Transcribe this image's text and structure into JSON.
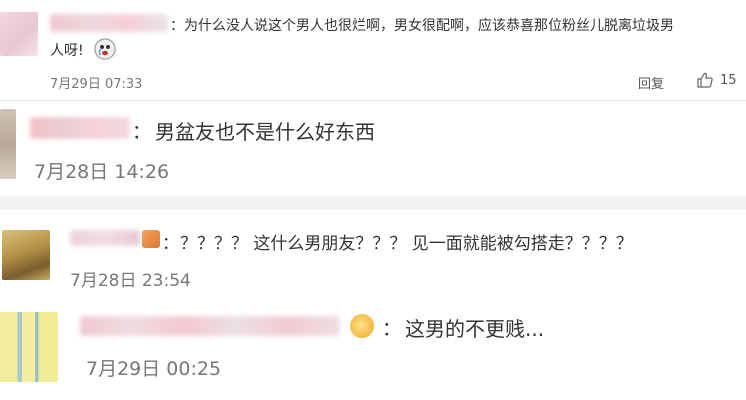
{
  "comments": [
    {
      "text": "：为什么没人说这个男人也很烂啊，男女很配啊，应该恭喜那位粉丝儿脱离垃圾男",
      "text_line2": "人呀!",
      "time": "7月29日 07:33",
      "reply_label": "回复",
      "like_count": "15",
      "icons": {
        "like": "thumbs-up-icon",
        "emoji": "crying-face-emoji-icon"
      }
    },
    {
      "colon": "：",
      "text": "男盆友也不是什么好东西",
      "time": "7月28日 14:26"
    },
    {
      "colon": "：",
      "text": "？？？？ 这什么男朋友？？？ 见一面就能被勾搭走？？？？",
      "time": "7月28日 23:54"
    },
    {
      "colon": "：",
      "text": "这男的不更贱...",
      "time": "7月29日 00:25"
    }
  ],
  "colors": {
    "background": "#f2f2f2",
    "panel": "#ffffff",
    "text": "#333333",
    "time": "#777777"
  }
}
